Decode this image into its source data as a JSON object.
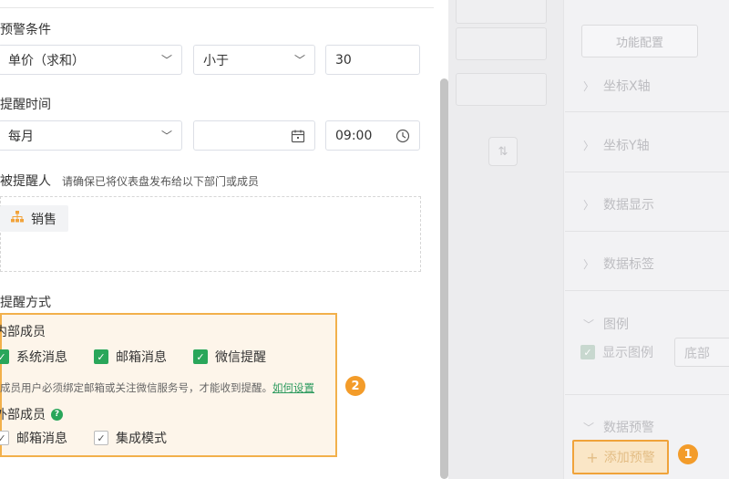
{
  "right_panel": {
    "config_tab": "功能配置",
    "sections": [
      "坐标X轴",
      "坐标Y轴",
      "数据显示",
      "数据标签",
      "图例",
      "数据预警"
    ],
    "show_legend_label": "显示图例",
    "legend_position": "底部",
    "add_warning_label": "添加预警"
  },
  "badges": {
    "one": "1",
    "two": "2"
  },
  "form": {
    "condition_label": "预警条件",
    "condition_field": "单价（求和）",
    "condition_operator": "小于",
    "condition_value": "30",
    "remind_time_label": "提醒时间",
    "frequency": "每月",
    "date": "",
    "time": "09:00",
    "recipient_label": "被提醒人",
    "recipient_hint": "请确保已将仪表盘发布给以下部门或成员",
    "recipient_tag": "销售",
    "method_label": "提醒方式",
    "internal_label": "内部成员",
    "internal_options": [
      "系统消息",
      "邮箱消息",
      "微信提醒"
    ],
    "note_text": "成员用户必须绑定邮箱或关注微信服务号，才能收到提醒。",
    "note_link": "如何设置",
    "external_label": "外部成员",
    "external_options": [
      "邮箱消息",
      "集成模式"
    ]
  },
  "icons": {
    "chevron": "chevron-down-icon",
    "calendar": "calendar-icon",
    "clock": "clock-icon",
    "org": "org-chart-icon",
    "check": "check-icon",
    "help": "help-icon",
    "sort": "sort-icon",
    "plus": "plus-icon"
  },
  "colors": {
    "accent_green": "#29a65a",
    "highlight_orange": "#f39c2a"
  }
}
